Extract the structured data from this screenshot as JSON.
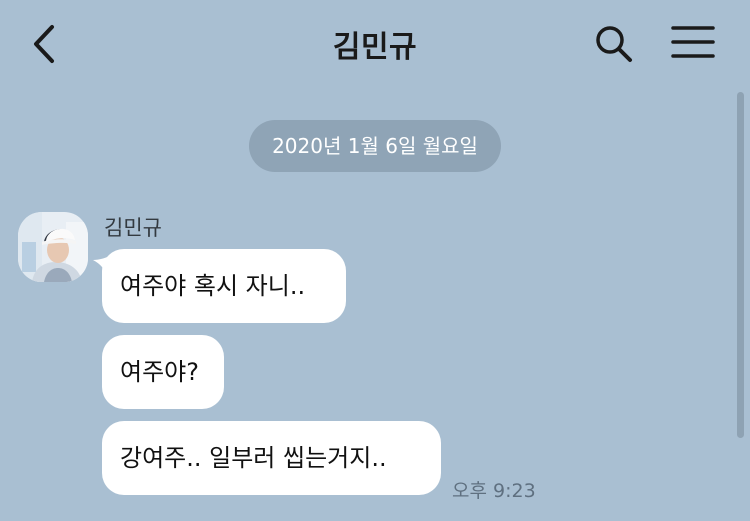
{
  "header": {
    "title": "김민규",
    "back_icon": "chevron-left-icon",
    "search_icon": "search-icon",
    "menu_icon": "hamburger-menu-icon"
  },
  "chat": {
    "date_label": "2020년 1월 6일 월요일",
    "sender_name": "김민규",
    "messages": [
      {
        "text": "여주야 혹시 자니.."
      },
      {
        "text": "여주야?"
      },
      {
        "text": "강여주.. 일부러 씹는거지.."
      }
    ],
    "timestamp": "오후 9:23"
  },
  "colors": {
    "background": "#a9bfd2",
    "date_pill": "#8fa4b6",
    "bubble": "#ffffff",
    "text": "#111111"
  }
}
